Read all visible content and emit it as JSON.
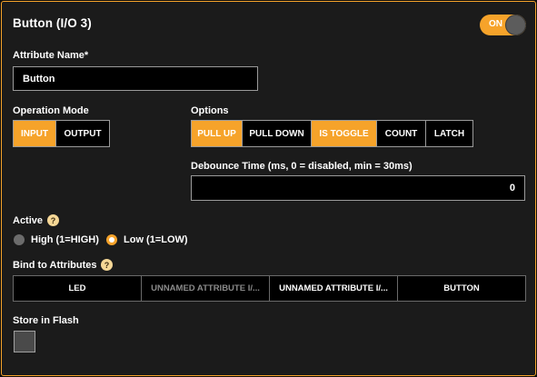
{
  "header": {
    "title": "Button (I/O 3)",
    "enabled_toggle": {
      "label": "ON",
      "state": "on"
    }
  },
  "attribute_name": {
    "label": "Attribute Name*",
    "value": "Button"
  },
  "operation_mode": {
    "label": "Operation Mode",
    "options": [
      {
        "label": "INPUT",
        "active": true
      },
      {
        "label": "OUTPUT",
        "active": false
      }
    ]
  },
  "options": {
    "label": "Options",
    "items": [
      {
        "label": "PULL UP",
        "active": true
      },
      {
        "label": "PULL DOWN",
        "active": false
      },
      {
        "label": "IS TOGGLE",
        "active": true
      },
      {
        "label": "COUNT",
        "active": false
      },
      {
        "label": "LATCH",
        "active": false
      }
    ]
  },
  "debounce": {
    "label": "Debounce Time (ms, 0 = disabled, min = 30ms)",
    "value": "0"
  },
  "active": {
    "label": "Active",
    "help_icon": "?",
    "choices": [
      {
        "label": "High (1=HIGH)",
        "selected": false
      },
      {
        "label": "Low (1=LOW)",
        "selected": true
      }
    ]
  },
  "bind_to_attributes": {
    "label": "Bind to Attributes",
    "help_icon": "?",
    "items": [
      {
        "label": "LED",
        "dim": false
      },
      {
        "label": "UNNAMED ATTRIBUTE I/...",
        "dim": true
      },
      {
        "label": "UNNAMED ATTRIBUTE I/...",
        "dim": false
      },
      {
        "label": "BUTTON",
        "dim": false
      }
    ]
  },
  "store_in_flash": {
    "label": "Store in Flash",
    "checked": false
  },
  "colors": {
    "accent": "#f6a32a",
    "panel_bg": "#1b1b1b",
    "field_bg": "#000000",
    "field_border": "#9a9a9a"
  }
}
